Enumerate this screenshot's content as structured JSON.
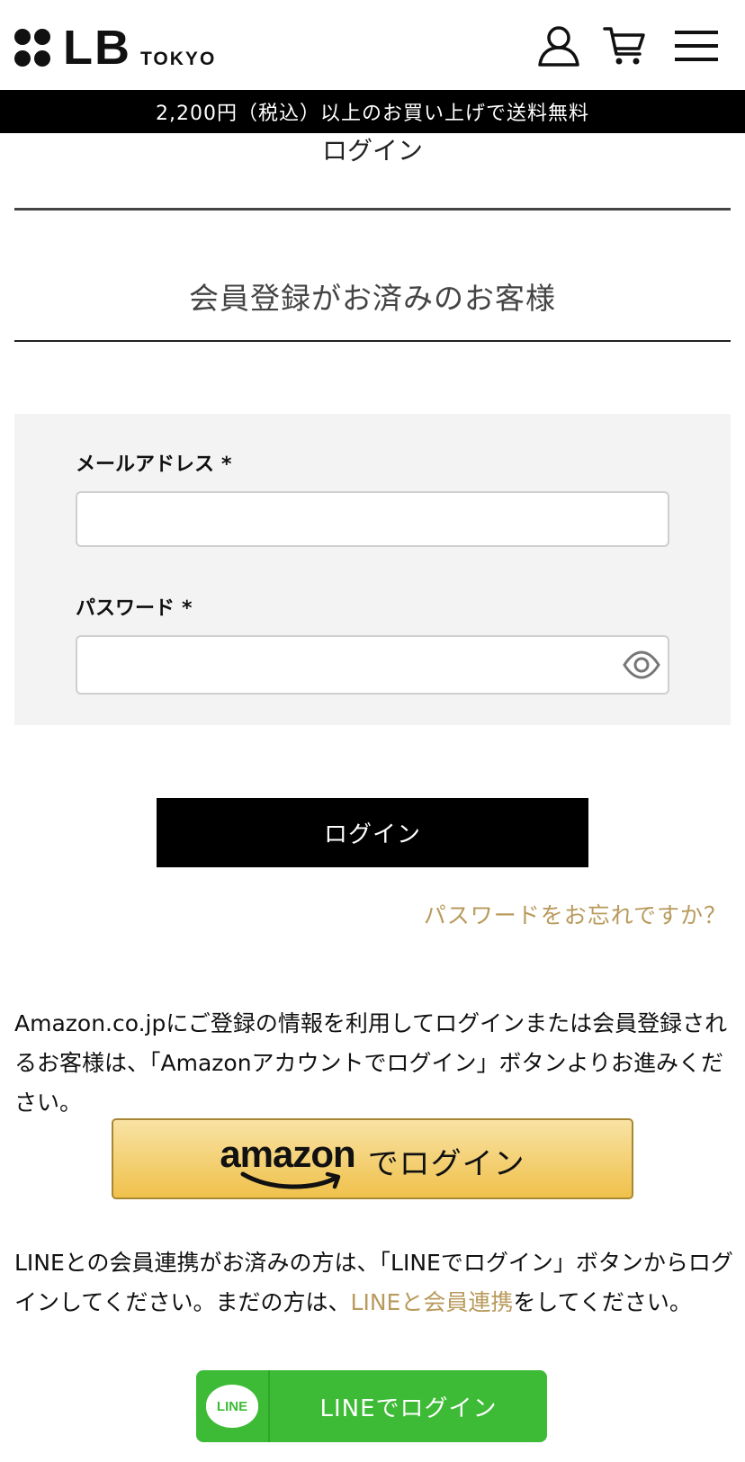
{
  "header": {
    "logo_main": "LB",
    "logo_sub": "TOKYO",
    "icons": [
      "user-icon",
      "cart-icon",
      "menu-icon"
    ]
  },
  "banner": {
    "text": "2,200円（税込）以上のお買い上げで送料無料"
  },
  "page": {
    "title": "ログイン"
  },
  "member_section": {
    "title": "会員登録がお済みのお客様",
    "email_label": "メールアドレス",
    "password_label": "パスワード",
    "required_mark": "*",
    "email_value": "",
    "password_value": ""
  },
  "actions": {
    "login_label": "ログイン",
    "forgot_label": "パスワードをお忘れですか？"
  },
  "amazon": {
    "description": "Amazon.co.jpにご登録の情報を利用してログインまたは会員登録されるお客様は、「Amazonアカウントでログイン」ボタンよりお進みください。",
    "logo_text": "amazon",
    "button_label": "でログイン"
  },
  "line": {
    "description_before": "LINEとの会員連携がお済みの方は、「LINEでログイン」ボタンからログインしてください。まだの方は、",
    "description_link": "LINEと会員連携",
    "description_after": "をしてください。",
    "icon_text": "LINE",
    "button_label": "LINEでログイン"
  },
  "colors": {
    "accent_gold": "#b89a5c",
    "line_green": "#3dbb36",
    "amazon_yellow": "#f0c14b"
  }
}
